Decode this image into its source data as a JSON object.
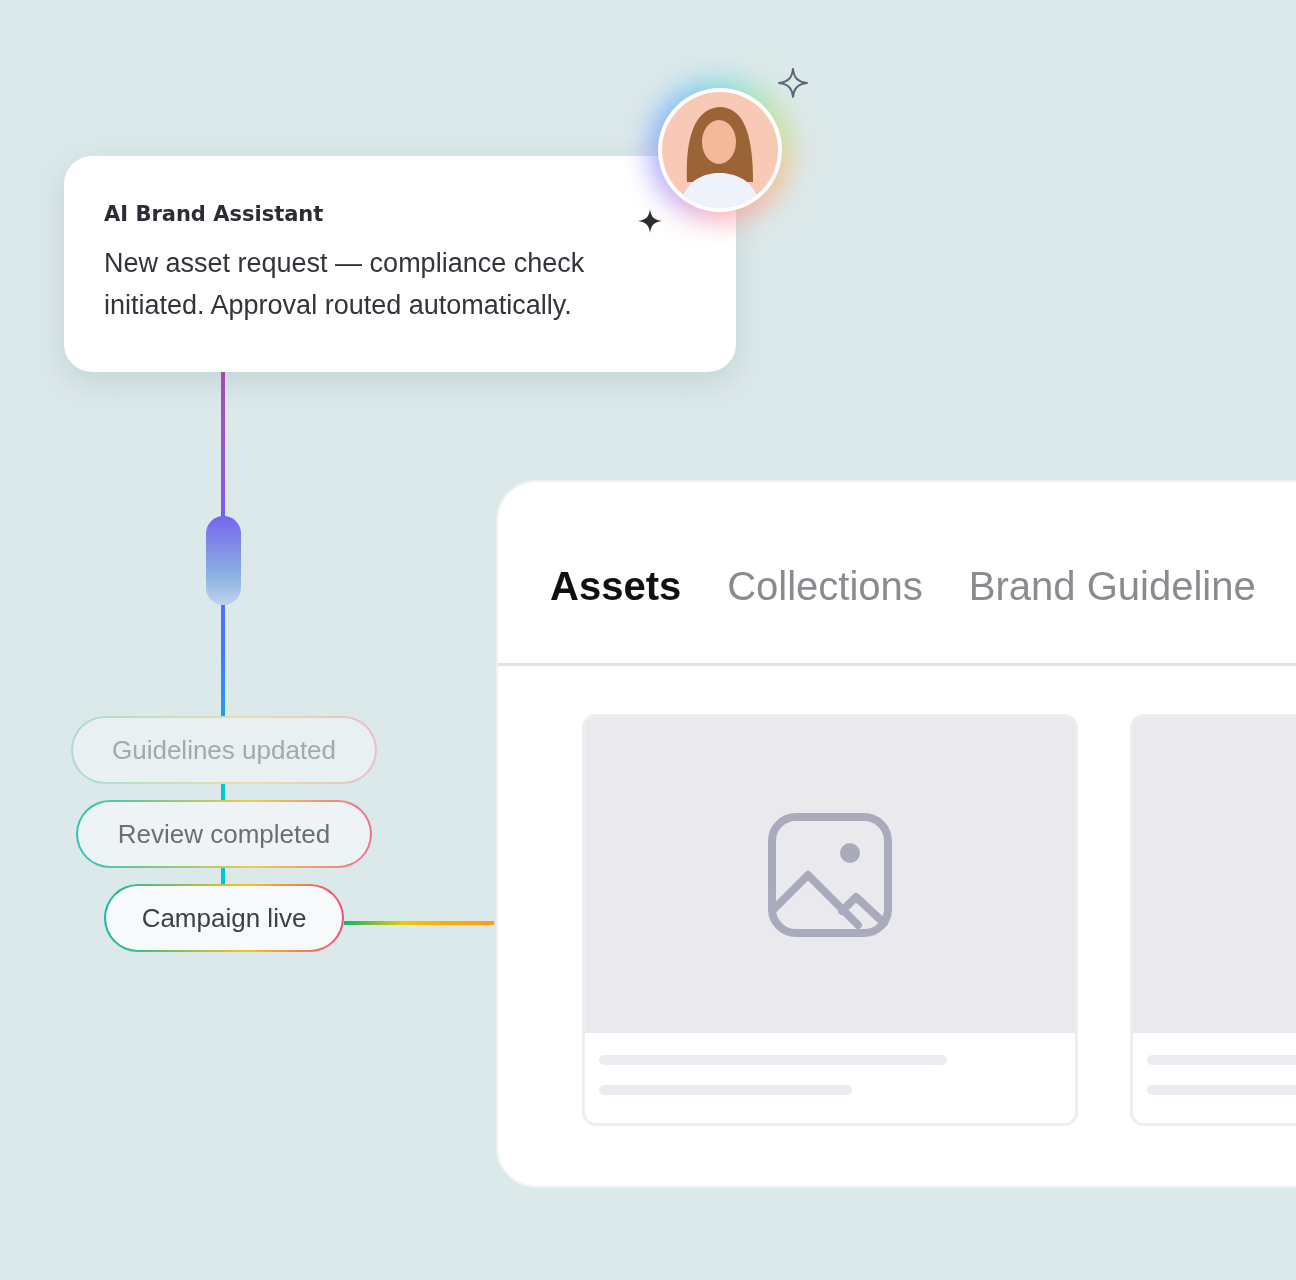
{
  "assistant_card": {
    "title": "AI Brand Assistant",
    "message": "New asset request — compliance check initiated. Approval routed automatically."
  },
  "timeline": [
    {
      "label": "Guidelines updated",
      "kind": "faded"
    },
    {
      "label": "Review completed",
      "kind": "muted"
    },
    {
      "label": "Campaign live",
      "kind": "current"
    }
  ],
  "tabs": [
    {
      "label": "Assets",
      "selected": true
    },
    {
      "label": "Collections",
      "selected": false
    },
    {
      "label": "Brand Guideline",
      "selected": false
    }
  ],
  "asset_cards": [
    {
      "kind": "whole"
    },
    {
      "kind": "cut"
    }
  ]
}
